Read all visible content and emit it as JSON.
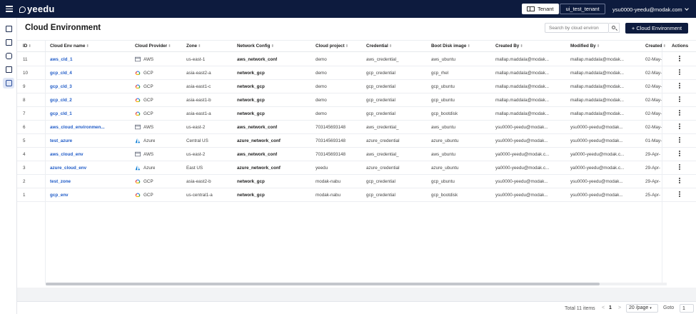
{
  "header": {
    "logo": "yeedu",
    "tenant_label": "Tenant",
    "tenant_name": "ui_test_tenant",
    "user": "ysu0000-yeedu@modak.com"
  },
  "nav": {
    "icons": [
      "workspace-icon",
      "chart-icon",
      "robot-icon",
      "machine-icon",
      "cloud-env-icon"
    ],
    "active_index": 4
  },
  "page": {
    "title": "Cloud Environment",
    "search_placeholder": "Search by cloud environ",
    "add_button": "+ Cloud Environment"
  },
  "table": {
    "columns": [
      "ID",
      "Cloud Env name",
      "Cloud Provider",
      "Zone",
      "Network Config",
      "Cloud project",
      "Credential",
      "Boot Disk image",
      "Created By",
      "Modified By",
      "Created",
      "Actions"
    ],
    "sortable": [
      true,
      true,
      true,
      true,
      true,
      true,
      true,
      true,
      true,
      true,
      true,
      false
    ],
    "rows": [
      {
        "id": "11",
        "name": "aws_cld_1",
        "provider": "AWS",
        "zone": "us-east-1",
        "network": "aws_network_conf",
        "project": "demo",
        "credential": "aws_credential_",
        "image": "aws_ubuntu",
        "created_by": "mallap.maddala@modak...",
        "modified_by": "mallap.maddala@modak...",
        "created": "02-May-"
      },
      {
        "id": "10",
        "name": "gcp_cld_4",
        "provider": "GCP",
        "zone": "asia-east2-a",
        "network": "network_gcp",
        "project": "demo",
        "credential": "gcp_credential",
        "image": "gcp_rhel",
        "created_by": "mallap.maddala@modak...",
        "modified_by": "mallap.maddala@modak...",
        "created": "02-May-"
      },
      {
        "id": "9",
        "name": "gcp_cld_3",
        "provider": "GCP",
        "zone": "asia-east1-c",
        "network": "network_gcp",
        "project": "demo",
        "credential": "gcp_credential",
        "image": "gcp_ubuntu",
        "created_by": "mallap.maddala@modak...",
        "modified_by": "mallap.maddala@modak...",
        "created": "02-May-"
      },
      {
        "id": "8",
        "name": "gcp_cld_2",
        "provider": "GCP",
        "zone": "asia-east1-b",
        "network": "network_gcp",
        "project": "demo",
        "credential": "gcp_credential",
        "image": "gcp_ubuntu",
        "created_by": "mallap.maddala@modak...",
        "modified_by": "mallap.maddala@modak...",
        "created": "02-May-"
      },
      {
        "id": "7",
        "name": "gcp_cld_1",
        "provider": "GCP",
        "zone": "asia-east1-a",
        "network": "network_gcp",
        "project": "demo",
        "credential": "gcp_credential",
        "image": "gcp_bootdisk",
        "created_by": "mallap.maddala@modak...",
        "modified_by": "mallap.maddala@modak...",
        "created": "02-May-"
      },
      {
        "id": "6",
        "name": "aws_cloud_environmen...",
        "provider": "AWS",
        "zone": "us-east-2",
        "network": "aws_network_conf",
        "project": "703145693148",
        "credential": "aws_credential_",
        "image": "aws_ubuntu",
        "created_by": "ysu0000-yeedu@modak...",
        "modified_by": "ysu0000-yeedu@modak...",
        "created": "02-May-"
      },
      {
        "id": "5",
        "name": "test_azure",
        "provider": "Azure",
        "zone": "Central US",
        "network": "azure_network_conf",
        "project": "703145693148",
        "credential": "azure_credential",
        "image": "azure_ubuntu",
        "created_by": "ysu0000-yeedu@modak...",
        "modified_by": "ysu0000-yeedu@modak...",
        "created": "01-May-"
      },
      {
        "id": "4",
        "name": "aws_cloud_env",
        "provider": "AWS",
        "zone": "us-east-2",
        "network": "aws_network_conf",
        "project": "703145693148",
        "credential": "aws_credential_",
        "image": "aws_ubuntu",
        "created_by": "ya0000-yeedu@modak.c...",
        "modified_by": "ya0000-yeedu@modak.c...",
        "created": "29-Apr-"
      },
      {
        "id": "3",
        "name": "azure_cloud_env",
        "provider": "Azure",
        "zone": "East US",
        "network": "azure_network_conf",
        "project": "yeedu",
        "credential": "azure_credential",
        "image": "azure_ubuntu",
        "created_by": "ya0000-yeedu@modak.c...",
        "modified_by": "ya0000-yeedu@modak.c...",
        "created": "29-Apr-"
      },
      {
        "id": "2",
        "name": "test_zone",
        "provider": "GCP",
        "zone": "asia-east2-b",
        "network": "network_gcp",
        "project": "modak-nabu",
        "credential": "gcp_credential",
        "image": "gcp_ubuntu",
        "created_by": "ysu0000-yeedu@modak...",
        "modified_by": "ysu0000-yeedu@modak...",
        "created": "29-Apr-"
      },
      {
        "id": "1",
        "name": "gcp_env",
        "provider": "GCP",
        "zone": "us-central1-a",
        "network": "network_gcp",
        "project": "modak-nabu",
        "credential": "gcp_credential",
        "image": "gcp_bootdisk",
        "created_by": "ysu0000-yeedu@modak...",
        "modified_by": "ysu0000-yeedu@modak...",
        "created": "25-Apr-"
      }
    ]
  },
  "footer": {
    "total": "Total 11 items",
    "prev": "<",
    "current_page": "1",
    "next": ">",
    "page_size": "20 /page",
    "goto_label": "Goto",
    "goto_value": "1"
  },
  "colors": {
    "brand": "#0d1b3e",
    "link": "#1f5bc7",
    "aws": "#6b7280",
    "azure": "#0078d4",
    "gcp_red": "#ea4335",
    "gcp_yellow": "#fbbc05",
    "gcp_green": "#34a853",
    "gcp_blue": "#4285f4"
  }
}
